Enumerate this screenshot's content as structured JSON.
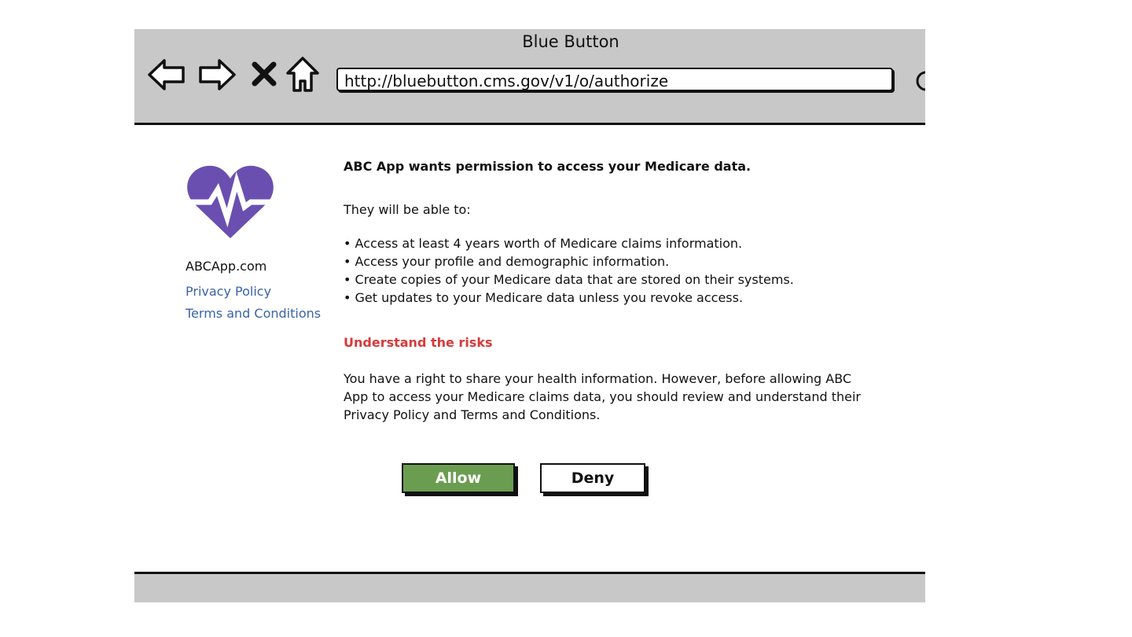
{
  "browser": {
    "window_title": "Blue Button",
    "url": "http://bluebutton.cms.gov/v1/o/authorize",
    "nav_icons": [
      "back-arrow-icon",
      "forward-arrow-icon",
      "close-x-icon",
      "home-icon"
    ]
  },
  "sidebar": {
    "logo_icon": "heartbeat-heart-icon",
    "logo_color": "#6a4fb0",
    "site_name": "ABCApp.com",
    "privacy_link": "Privacy Policy",
    "terms_link": "Terms and Conditions",
    "link_color": "#3a64a8"
  },
  "content": {
    "heading": "ABC App wants permission to access your Medicare data.",
    "intro": "They will be able to:",
    "permissions": [
      "Access at least 4 years worth of Medicare claims information.",
      "Access your profile and demographic information.",
      "Create copies of your Medicare data that are stored on their systems.",
      "Get updates to your Medicare data unless you revoke access."
    ],
    "risk_title": "Understand the risks",
    "risk_color": "#d63a3a",
    "risk_body": "You have a right to share your health information.  However, before allowing ABC App to access your Medicare claims data, you should review and understand their Privacy Policy and Terms and Conditions."
  },
  "actions": {
    "allow_label": "Allow",
    "deny_label": "Deny",
    "allow_color": "#6b9d51"
  }
}
